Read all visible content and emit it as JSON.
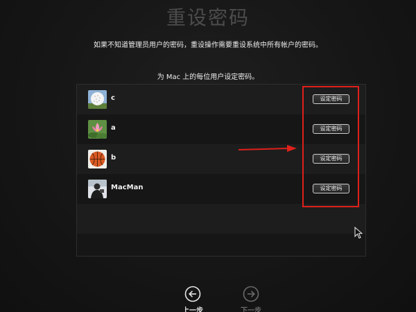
{
  "header": {
    "title": "重设密码",
    "subtitle": "如果不知道管理员用户的密码，重设操作需要重设系统中所有帐户的密码。",
    "instruction": "为 Mac 上的每位用户设定密码。"
  },
  "users": [
    {
      "name": "c",
      "avatar_icon": "golf-ball-icon",
      "button_label": "设定密码"
    },
    {
      "name": "a",
      "avatar_icon": "lotus-flower-icon",
      "button_label": "设定密码"
    },
    {
      "name": "b",
      "avatar_icon": "basketball-icon",
      "button_label": "设定密码"
    },
    {
      "name": "MacMan",
      "avatar_icon": "person-photo-icon",
      "button_label": "设定密码"
    }
  ],
  "navigation": {
    "back_label": "上一步",
    "next_label": "下一步"
  },
  "annotation": {
    "highlight_color": "#e0201a",
    "arrow_color": "#e0201a"
  }
}
